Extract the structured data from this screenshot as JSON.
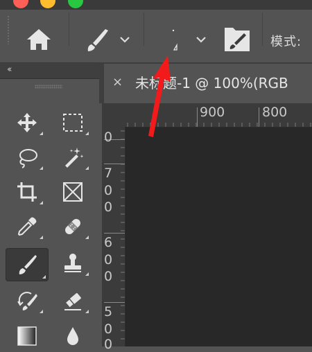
{
  "window": {
    "traffic_lights": [
      "close",
      "minimize",
      "maximize"
    ]
  },
  "options_bar": {
    "home_icon": "home-icon",
    "brush_preset_icon": "brush-icon",
    "brush_settings_icon": "brush-tip-icon",
    "panel_icon": "brush-settings-panel-icon",
    "mode_label": "模式:"
  },
  "tool_panel": {
    "collapse_glyph": "‹‹"
  },
  "document_tab": {
    "close_glyph": "×",
    "title": "未标题-1 @ 100%(RGB"
  },
  "rulers": {
    "top_labels": [
      "900",
      "800"
    ],
    "left_groups": [
      [
        "0"
      ],
      [
        "7",
        "0",
        "0"
      ],
      [
        "6",
        "0",
        "0"
      ],
      [
        "5",
        "0",
        "0"
      ]
    ]
  },
  "colors": {
    "panel": "#535353",
    "canvas": "#282828",
    "annotation": "#f21a1a"
  }
}
